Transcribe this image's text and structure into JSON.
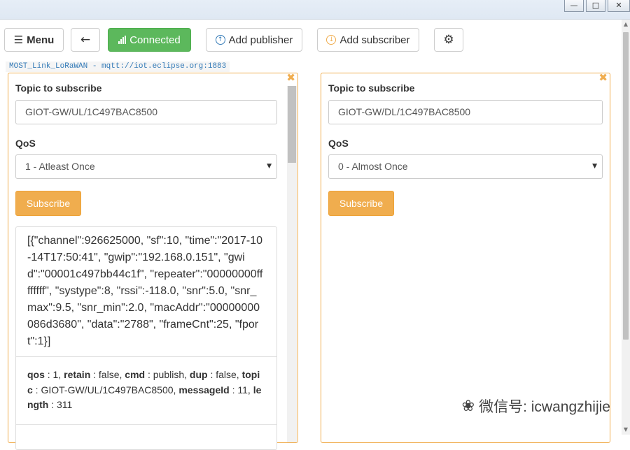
{
  "window": {
    "minimize": "—",
    "restore": "□",
    "close": "✕"
  },
  "toolbar": {
    "menu_icon": "☰",
    "menu": "Menu",
    "back_icon": "←",
    "connected": "Connected",
    "add_publisher": "Add publisher",
    "add_subscriber": "Add subscriber",
    "settings_icon": "⚙"
  },
  "connection": {
    "label": "MOST_Link_LoRaWAN - mqtt://iot.eclipse.org:1883"
  },
  "subscribers": [
    {
      "close_icon": "✖",
      "topic_label": "Topic to subscribe",
      "topic_value": "GIOT-GW/UL/1C497BAC8500",
      "qos_label": "QoS",
      "qos_selected": "1 - Atleast Once",
      "subscribe_button": "Subscribe",
      "message": {
        "payload": "[{\"channel\":926625000, \"sf\":10, \"time\":\"2017-10-14T17:50:41\", \"gwip\":\"192.168.0.151\", \"gwid\":\"00001c497bb44c1f\", \"repeater\":\"00000000ffffffff\", \"systype\":8, \"rssi\":-118.0, \"snr\":5.0, \"snr_max\":9.5, \"snr_min\":2.0, \"macAddr\":\"00000000086d3680\", \"data\":\"2788\", \"frameCnt\":25, \"fport\":1}]",
        "meta": {
          "qos_key": "qos",
          "qos_val": " : 1, ",
          "retain_key": "retain",
          "retain_val": " : false, ",
          "cmd_key": "cmd",
          "cmd_val": " : publish, ",
          "dup_key": "dup",
          "dup_val": " : false, ",
          "topic_key": "topic",
          "topic_val": " : GIOT-GW/UL/1C497BAC8500, ",
          "messageid_key": "messageId",
          "messageid_val": " : 11, ",
          "length_key": "length",
          "length_val": " : 311"
        }
      }
    },
    {
      "close_icon": "✖",
      "topic_label": "Topic to subscribe",
      "topic_value": "GIOT-GW/DL/1C497BAC8500",
      "qos_label": "QoS",
      "qos_selected": "0 - Almost Once",
      "subscribe_button": "Subscribe"
    }
  ],
  "watermark": {
    "icon": "❀",
    "text": "微信号: icwangzhijie"
  },
  "colors": {
    "connected": "#5cb85c",
    "warning": "#f0ad4e",
    "link": "#337ab7"
  }
}
